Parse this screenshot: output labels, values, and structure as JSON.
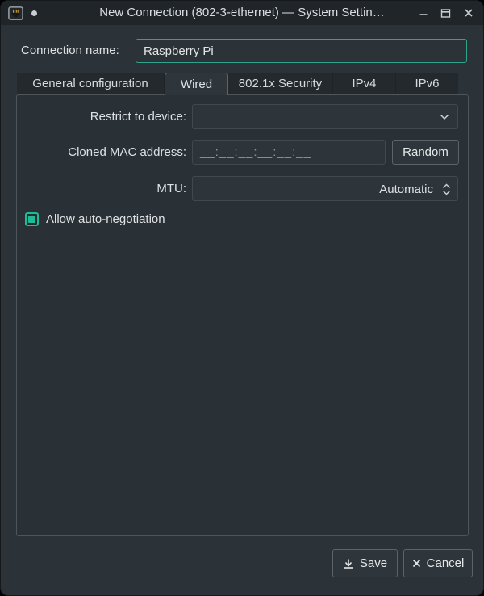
{
  "titlebar": {
    "title": "New Connection (802-3-ethernet) — System Settin…",
    "app_icon": "ethernet-port-icon",
    "controls": {
      "minimize": "minimize-icon",
      "maximize": "maximize-icon",
      "close": "close-icon"
    }
  },
  "connection_name": {
    "label": "Connection name:",
    "value": "Raspberry Pi"
  },
  "tabs": [
    {
      "label": "General configuration",
      "active": false
    },
    {
      "label": "Wired",
      "active": true
    },
    {
      "label": "802.1x Security",
      "active": false
    },
    {
      "label": "IPv4",
      "active": false
    },
    {
      "label": "IPv6",
      "active": false
    }
  ],
  "wired_tab": {
    "restrict_to_device": {
      "label": "Restrict to device:",
      "value": ""
    },
    "cloned_mac": {
      "label": "Cloned MAC address:",
      "placeholder": "__:__:__:__:__:__",
      "random_button": "Random"
    },
    "mtu": {
      "label": "MTU:",
      "value": "Automatic"
    },
    "auto_negotiation": {
      "label": "Allow auto-negotiation",
      "checked": true
    }
  },
  "footer": {
    "save_button": "Save",
    "cancel_button": "Cancel"
  },
  "colors": {
    "accent_teal": "#1ebc96",
    "focus_border": "#2da58c",
    "window_bg": "#2c3338",
    "titlebar_bg": "#1f2529"
  }
}
